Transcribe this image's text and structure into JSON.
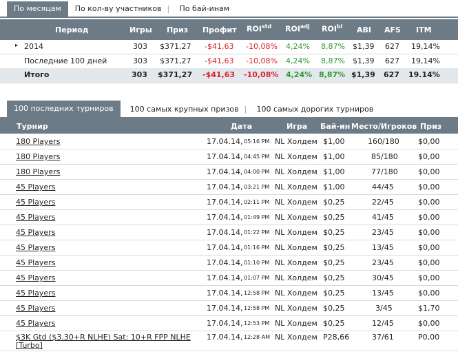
{
  "tabs_top": [
    "По месяцам",
    "По кол-ву участников",
    "По бай-инам"
  ],
  "summary": {
    "headers": {
      "period": "Период",
      "games": "Игры",
      "prize": "Приз",
      "profit": "Профит",
      "roi": "ROI",
      "roi_std": "std",
      "roi_adj": "adj",
      "roi_bi": "bi",
      "abi": "ABI",
      "afs": "AFS",
      "itm": "ITM"
    },
    "rows": [
      {
        "expand": "▸",
        "period": "2014",
        "games": "303",
        "prize": "$371,27",
        "profit": "-$41,63",
        "roi_std": "-10,08%",
        "roi_adj": "4,24%",
        "roi_bi": "8,87%",
        "abi": "$1,39",
        "afs": "627",
        "itm": "19,14%"
      },
      {
        "expand": "",
        "period": "Последние 100 дней",
        "games": "303",
        "prize": "$371,27",
        "profit": "-$41,63",
        "roi_std": "-10,08%",
        "roi_adj": "4,24%",
        "roi_bi": "8,87%",
        "abi": "$1,39",
        "afs": "627",
        "itm": "19,14%"
      }
    ],
    "total": {
      "period": "Итого",
      "games": "303",
      "prize": "$371,27",
      "profit": "-$41,63",
      "roi_std": "-10,08%",
      "roi_adj": "4,24%",
      "roi_bi": "8,87%",
      "abi": "$1,39",
      "afs": "627",
      "itm": "19.14%"
    }
  },
  "tabs_bottom": [
    "100 последних турниров",
    "100 самых крупных призов",
    "100 самых дорогих турниров"
  ],
  "tournaments": {
    "headers": {
      "name": "Турнир",
      "date": "Дата",
      "game": "Игра",
      "buyin": "Бай-ин",
      "place": "Место/Игроков",
      "prize": "Приз"
    },
    "rows": [
      {
        "name": "180 Players",
        "date": "17.04.14,",
        "time": "05:16 PM",
        "game": "NL Холдем",
        "buyin": "$1,00",
        "place": "160/180",
        "prize": "$0,00"
      },
      {
        "name": "180 Players",
        "date": "17.04.14,",
        "time": "04:45 PM",
        "game": "NL Холдем",
        "buyin": "$1,00",
        "place": "85/180",
        "prize": "$0,00"
      },
      {
        "name": "180 Players",
        "date": "17.04.14,",
        "time": "04:00 PM",
        "game": "NL Холдем",
        "buyin": "$1,00",
        "place": "77/180",
        "prize": "$0,00"
      },
      {
        "name": "45 Players",
        "date": "17.04.14,",
        "time": "03:21 PM",
        "game": "NL Холдем",
        "buyin": "$1,00",
        "place": "44/45",
        "prize": "$0,00"
      },
      {
        "name": "45 Players",
        "date": "17.04.14,",
        "time": "02:11 PM",
        "game": "NL Холдем",
        "buyin": "$0,25",
        "place": "22/45",
        "prize": "$0,00"
      },
      {
        "name": "45 Players",
        "date": "17.04.14,",
        "time": "01:49 PM",
        "game": "NL Холдем",
        "buyin": "$0,25",
        "place": "41/45",
        "prize": "$0,00"
      },
      {
        "name": "45 Players",
        "date": "17.04.14,",
        "time": "01:22 PM",
        "game": "NL Холдем",
        "buyin": "$0,25",
        "place": "23/45",
        "prize": "$0,00"
      },
      {
        "name": "45 Players",
        "date": "17.04.14,",
        "time": "01:16 PM",
        "game": "NL Холдем",
        "buyin": "$0,25",
        "place": "13/45",
        "prize": "$0,00"
      },
      {
        "name": "45 Players",
        "date": "17.04.14,",
        "time": "01:10 PM",
        "game": "NL Холдем",
        "buyin": "$0,25",
        "place": "23/45",
        "prize": "$0,00"
      },
      {
        "name": "45 Players",
        "date": "17.04.14,",
        "time": "01:07 PM",
        "game": "NL Холдем",
        "buyin": "$0,25",
        "place": "30/45",
        "prize": "$0,00"
      },
      {
        "name": "45 Players",
        "date": "17.04.14,",
        "time": "12:58 PM",
        "game": "NL Холдем",
        "buyin": "$0,25",
        "place": "13/45",
        "prize": "$0,00"
      },
      {
        "name": "45 Players",
        "date": "17.04.14,",
        "time": "12:58 PM",
        "game": "NL Холдем",
        "buyin": "$0,25",
        "place": "3/45",
        "prize": "$1,70"
      },
      {
        "name": "45 Players",
        "date": "17.04.14,",
        "time": "12:53 PM",
        "game": "NL Холдем",
        "buyin": "$0,25",
        "place": "12/45",
        "prize": "$0,00"
      },
      {
        "name": "$3K Gtd ($3.30+R NLHE) Sat: 10+R FPP NLHE",
        "name2": "[Turbo]",
        "date": "17.04.14,",
        "time": "12:28 AM",
        "game": "NL Холдем",
        "buyin": "P28,66",
        "place": "37/61",
        "prize": "P0,00"
      }
    ]
  }
}
